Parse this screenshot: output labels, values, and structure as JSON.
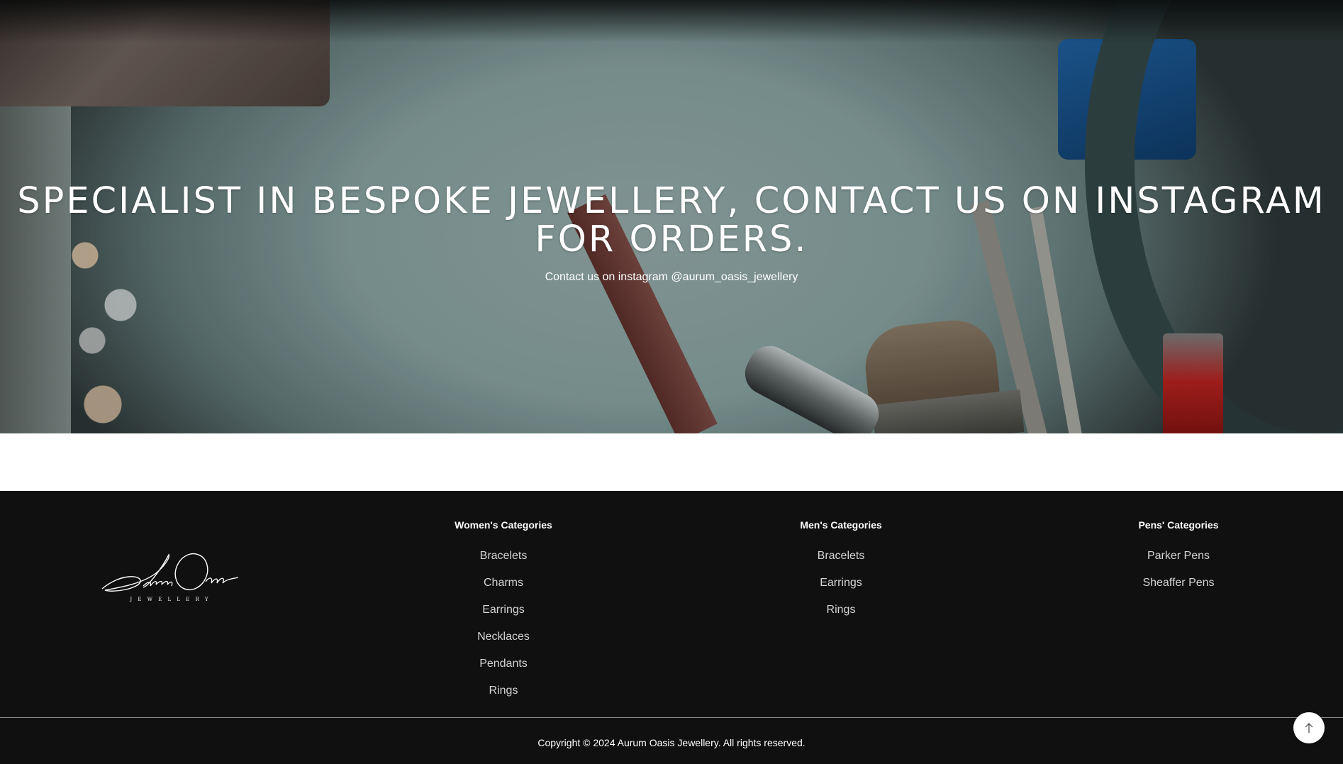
{
  "hero": {
    "title": "SPECIALIST IN BESPOKE JEWELLERY, CONTACT US ON INSTAGRAM FOR ORDERS.",
    "subtitle": "Contact us on instagram @aurum_oasis_jewellery"
  },
  "footer": {
    "logo": {
      "script_text": "Aurum Oasis",
      "tagline": "J E W E L L E R Y"
    },
    "columns": [
      {
        "title": "Women's Categories",
        "items": [
          "Bracelets",
          "Charms",
          "Earrings",
          "Necklaces",
          "Pendants",
          "Rings"
        ]
      },
      {
        "title": "Men's Categories",
        "items": [
          "Bracelets",
          "Earrings",
          "Rings"
        ]
      },
      {
        "title": "Pens' Categories",
        "items": [
          "Parker Pens",
          "Sheaffer Pens"
        ]
      }
    ],
    "copyright": "Copyright © 2024 Aurum Oasis Jewellery. All rights reserved."
  },
  "back_to_top": {
    "icon": "arrow-up-icon"
  },
  "colors": {
    "footer_bg": "#101010",
    "hero_text": "#ffffff",
    "link_text": "#d4d4d4"
  }
}
